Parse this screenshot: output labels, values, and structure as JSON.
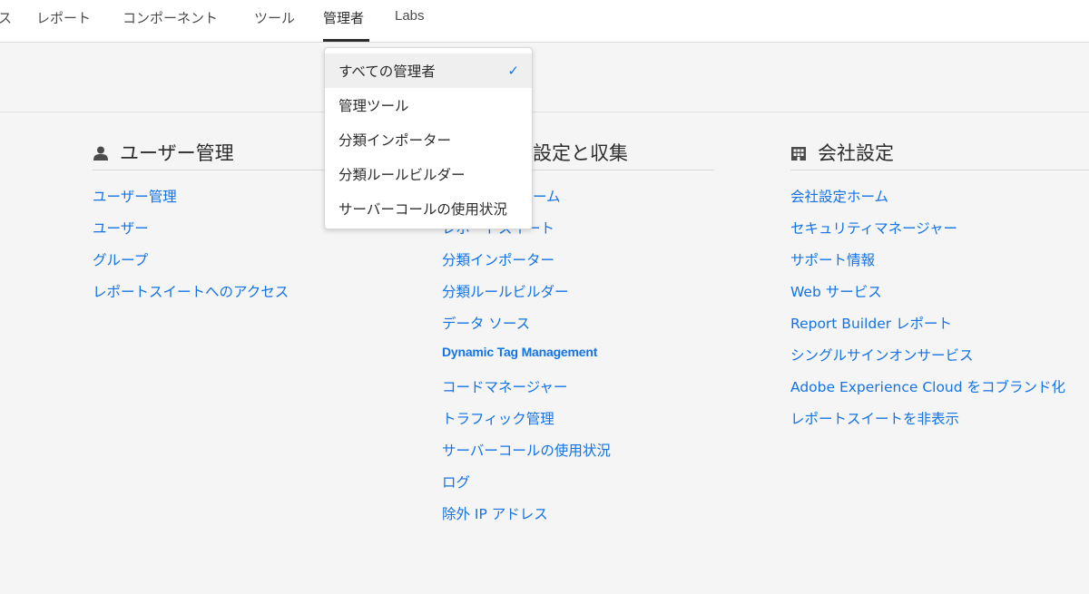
{
  "nav": {
    "items": [
      "ス",
      "レポート",
      "コンポーネント",
      "ツール",
      "管理者",
      "Labs"
    ],
    "active": "管理者"
  },
  "dropdown": {
    "items": [
      "すべての管理者",
      "管理ツール",
      "分類インポーター",
      "分類ルールビルダー",
      "サーバーコールの使用状況"
    ],
    "selected": "すべての管理者",
    "check_glyph": "✓"
  },
  "sections": {
    "users": {
      "title": "ユーザー管理",
      "icon": "user-icon",
      "links": [
        "ユーザー管理",
        "ユーザー",
        "グループ",
        "レポートスイートへのアクセス"
      ]
    },
    "data": {
      "title": "設定と収集",
      "links": [
        "ーム",
        "レポートスイート",
        "分類インポーター",
        "分類ルールビルダー",
        "データ ソース",
        "Dynamic Tag Management",
        "コードマネージャー",
        "トラフィック管理",
        "サーバーコールの使用状況",
        "ログ",
        "除外 IP アドレス"
      ]
    },
    "company": {
      "title": "会社設定",
      "icon": "building-icon",
      "links": [
        "会社設定ホーム",
        "セキュリティマネージャー",
        "サポート情報",
        "Web サービス",
        "Report Builder レポート",
        "シングルサインオンサービス",
        "Adobe Experience Cloud をコブランド化",
        "レポートスイートを非表示"
      ]
    }
  },
  "colors": {
    "link": "#1473e6",
    "text": "#2c2c2c",
    "background": "#f5f5f5",
    "nav_background": "#ffffff"
  }
}
